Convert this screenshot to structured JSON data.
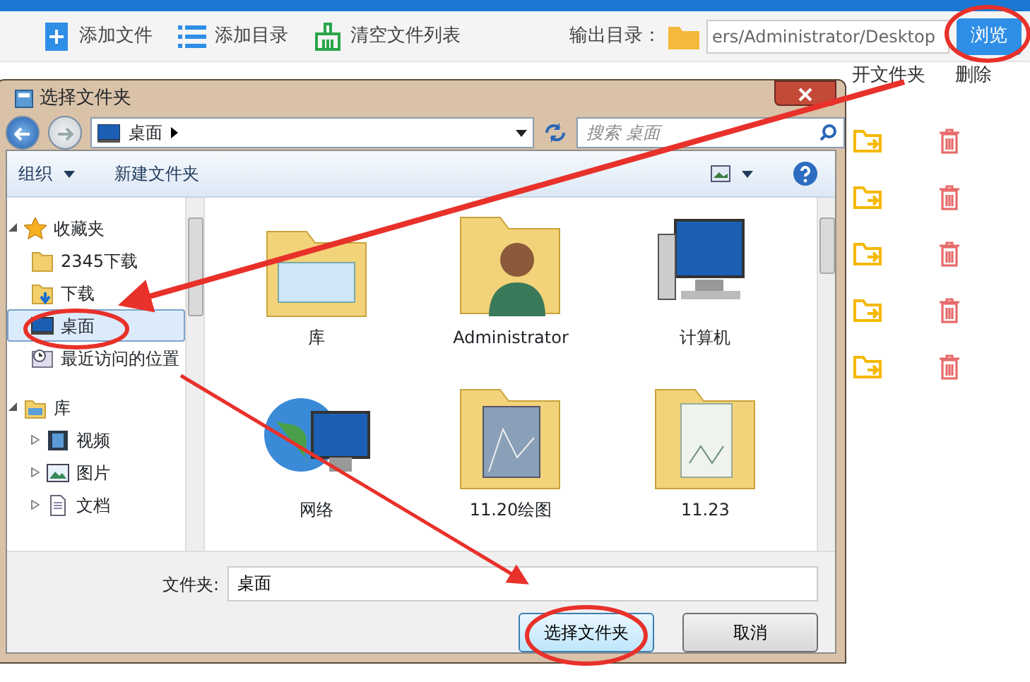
{
  "app": {
    "toolbar": [
      {
        "label": "添加文件",
        "kind": "add-file"
      },
      {
        "label": "添加目录",
        "kind": "list"
      },
      {
        "label": "清空文件列表",
        "kind": "broom"
      }
    ],
    "output_label": "输出目录：",
    "output_path": "ers/Administrator/Desktop",
    "browse_button": "浏览",
    "columns": [
      "开文件夹",
      "删除"
    ],
    "rows": [
      {
        "kind": "file"
      },
      {
        "kind": "file"
      },
      {
        "kind": "file"
      },
      {
        "kind": "file"
      },
      {
        "kind": "file"
      }
    ]
  },
  "dialog": {
    "title": "选择文件夹",
    "location": "桌面",
    "search_placeholder": "搜索 桌面",
    "commands": [
      {
        "label": "组织",
        "dropdown": true
      },
      {
        "label": "新建文件夹",
        "dropdown": false
      }
    ],
    "nav": [
      {
        "label": "收藏夹",
        "kind": "star",
        "expanded": true,
        "selected": false,
        "children": [
          {
            "label": "2345下载",
            "kind": "folder",
            "selected": false
          },
          {
            "label": "下载",
            "kind": "download",
            "selected": false
          },
          {
            "label": "桌面",
            "kind": "desktop",
            "selected": true
          },
          {
            "label": "最近访问的位置",
            "kind": "recent",
            "selected": false
          }
        ]
      },
      {
        "label": "库",
        "kind": "library",
        "expanded": true,
        "selected": false,
        "children": [
          {
            "label": "视频",
            "kind": "video",
            "selected": false,
            "expanded": false
          },
          {
            "label": "图片",
            "kind": "picture",
            "selected": false,
            "expanded": false
          },
          {
            "label": "文档",
            "kind": "document",
            "selected": false,
            "expanded": false
          }
        ]
      }
    ],
    "items": [
      {
        "label": "库",
        "kind": "library"
      },
      {
        "label": "Administrator",
        "kind": "user"
      },
      {
        "label": "计算机",
        "kind": "computer"
      },
      {
        "label": "网络",
        "kind": "network"
      },
      {
        "label": "11.20绘图",
        "kind": "folder-drawing"
      },
      {
        "label": "11.23",
        "kind": "folder-plain"
      }
    ],
    "folder_label": "文件夹:",
    "folder_value": "桌面",
    "buttons": [
      {
        "label": "选择文件夹",
        "primary": true
      },
      {
        "label": "取消",
        "primary": false
      }
    ]
  }
}
